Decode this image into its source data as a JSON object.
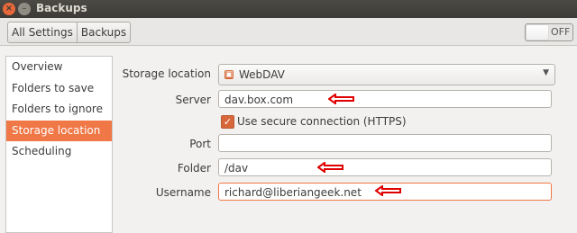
{
  "window": {
    "title": "Backups",
    "close_glyph": "×",
    "min_glyph": "–"
  },
  "toolbar": {
    "all_settings": "All Settings",
    "backups": "Backups",
    "switch_label": "OFF"
  },
  "sidebar": {
    "items": [
      "Overview",
      "Folders to save",
      "Folders to ignore",
      "Storage location",
      "Scheduling"
    ]
  },
  "form": {
    "storage_location_label": "Storage location",
    "storage_location_value": "WebDAV",
    "server_label": "Server",
    "server_value": "dav.box.com",
    "secure_label": "Use secure connection (HTTPS)",
    "port_label": "Port",
    "port_value": "",
    "folder_label": "Folder",
    "folder_value": "/dav",
    "username_label": "Username",
    "username_value": "richard@liberiangeek.net"
  },
  "colors": {
    "accent": "#f07746",
    "annotation_arrow": "#e00000",
    "titlebar": "#3c3b37"
  },
  "icons": [
    "close-icon",
    "minimize-icon",
    "webdav-icon",
    "chevron-down-icon",
    "checkmark-icon",
    "red-arrow-annotation"
  ]
}
